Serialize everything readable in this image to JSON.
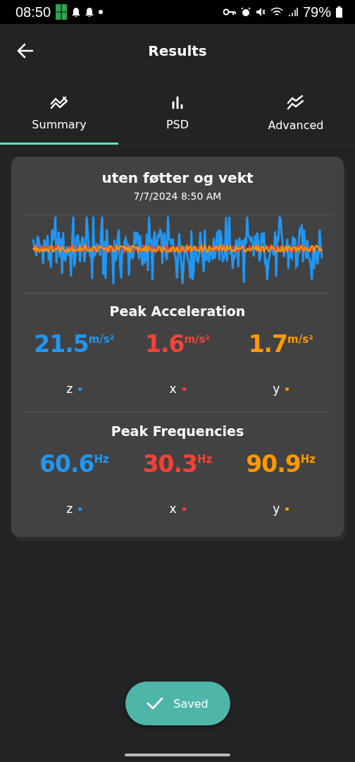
{
  "status_bar": {
    "time": "08:50",
    "battery": "79%"
  },
  "header": {
    "title": "Results"
  },
  "tabs": [
    {
      "label": "Summary",
      "kind": "trend",
      "selected": true
    },
    {
      "label": "PSD",
      "kind": "bars",
      "selected": false
    },
    {
      "label": "Advanced",
      "kind": "double",
      "selected": false
    }
  ],
  "recording": {
    "title": "uten føtter og vekt",
    "date": "7/7/2024 8:50 AM"
  },
  "sections": [
    {
      "title": "Peak Acceleration",
      "metrics": [
        {
          "value": "21.5",
          "unit": "m/s²",
          "axis": "z",
          "color": "#2196f3"
        },
        {
          "value": "1.6",
          "unit": "m/s²",
          "axis": "x",
          "color": "#f44336"
        },
        {
          "value": "1.7",
          "unit": "m/s²",
          "axis": "y",
          "color": "#ff9800"
        }
      ]
    },
    {
      "title": "Peak Frequencies",
      "metrics": [
        {
          "value": "60.6",
          "unit": "Hz",
          "axis": "z",
          "color": "#2196f3"
        },
        {
          "value": "30.3",
          "unit": "Hz",
          "axis": "x",
          "color": "#f44336"
        },
        {
          "value": "90.9",
          "unit": "Hz",
          "axis": "y",
          "color": "#ff9800"
        }
      ]
    }
  ],
  "save_button": {
    "label": "Saved"
  }
}
